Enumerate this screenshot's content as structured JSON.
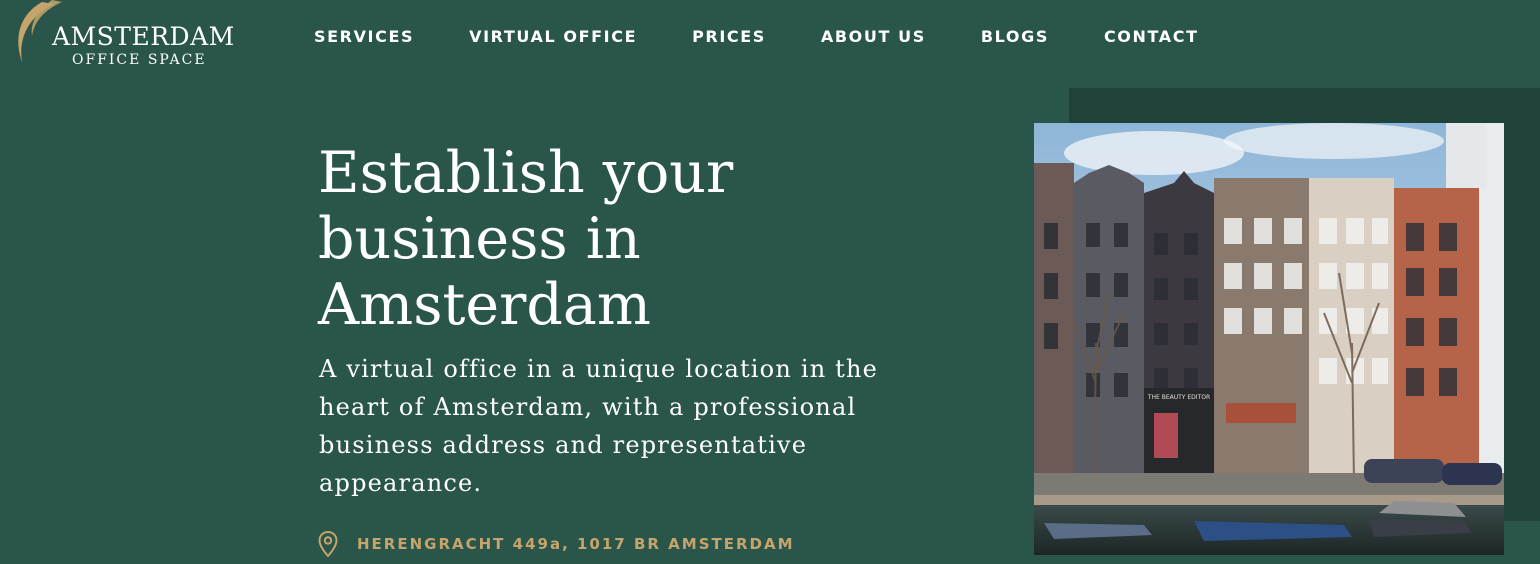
{
  "colors": {
    "background": "#29554a",
    "accent_gold": "#c7a46b",
    "backdrop": "#1f4338"
  },
  "logo": {
    "main": "AMSTERDAM",
    "sub": "OFFICE SPACE"
  },
  "nav": {
    "items": [
      {
        "label": "SERVICES"
      },
      {
        "label": "VIRTUAL OFFICE"
      },
      {
        "label": "PRICES"
      },
      {
        "label": "ABOUT US"
      },
      {
        "label": "BLOGS"
      },
      {
        "label": "CONTACT"
      }
    ]
  },
  "hero": {
    "title": "Establish your business in Amsterdam",
    "text": "A virtual office in a unique location in the heart of Amsterdam, with a professional business address and representative appearance.",
    "address": "HERENGRACHT 449a, 1017 BR AMSTERDAM",
    "address_icon": "map-pin-icon",
    "photo_sign": "THE BEAUTY EDITOR"
  }
}
